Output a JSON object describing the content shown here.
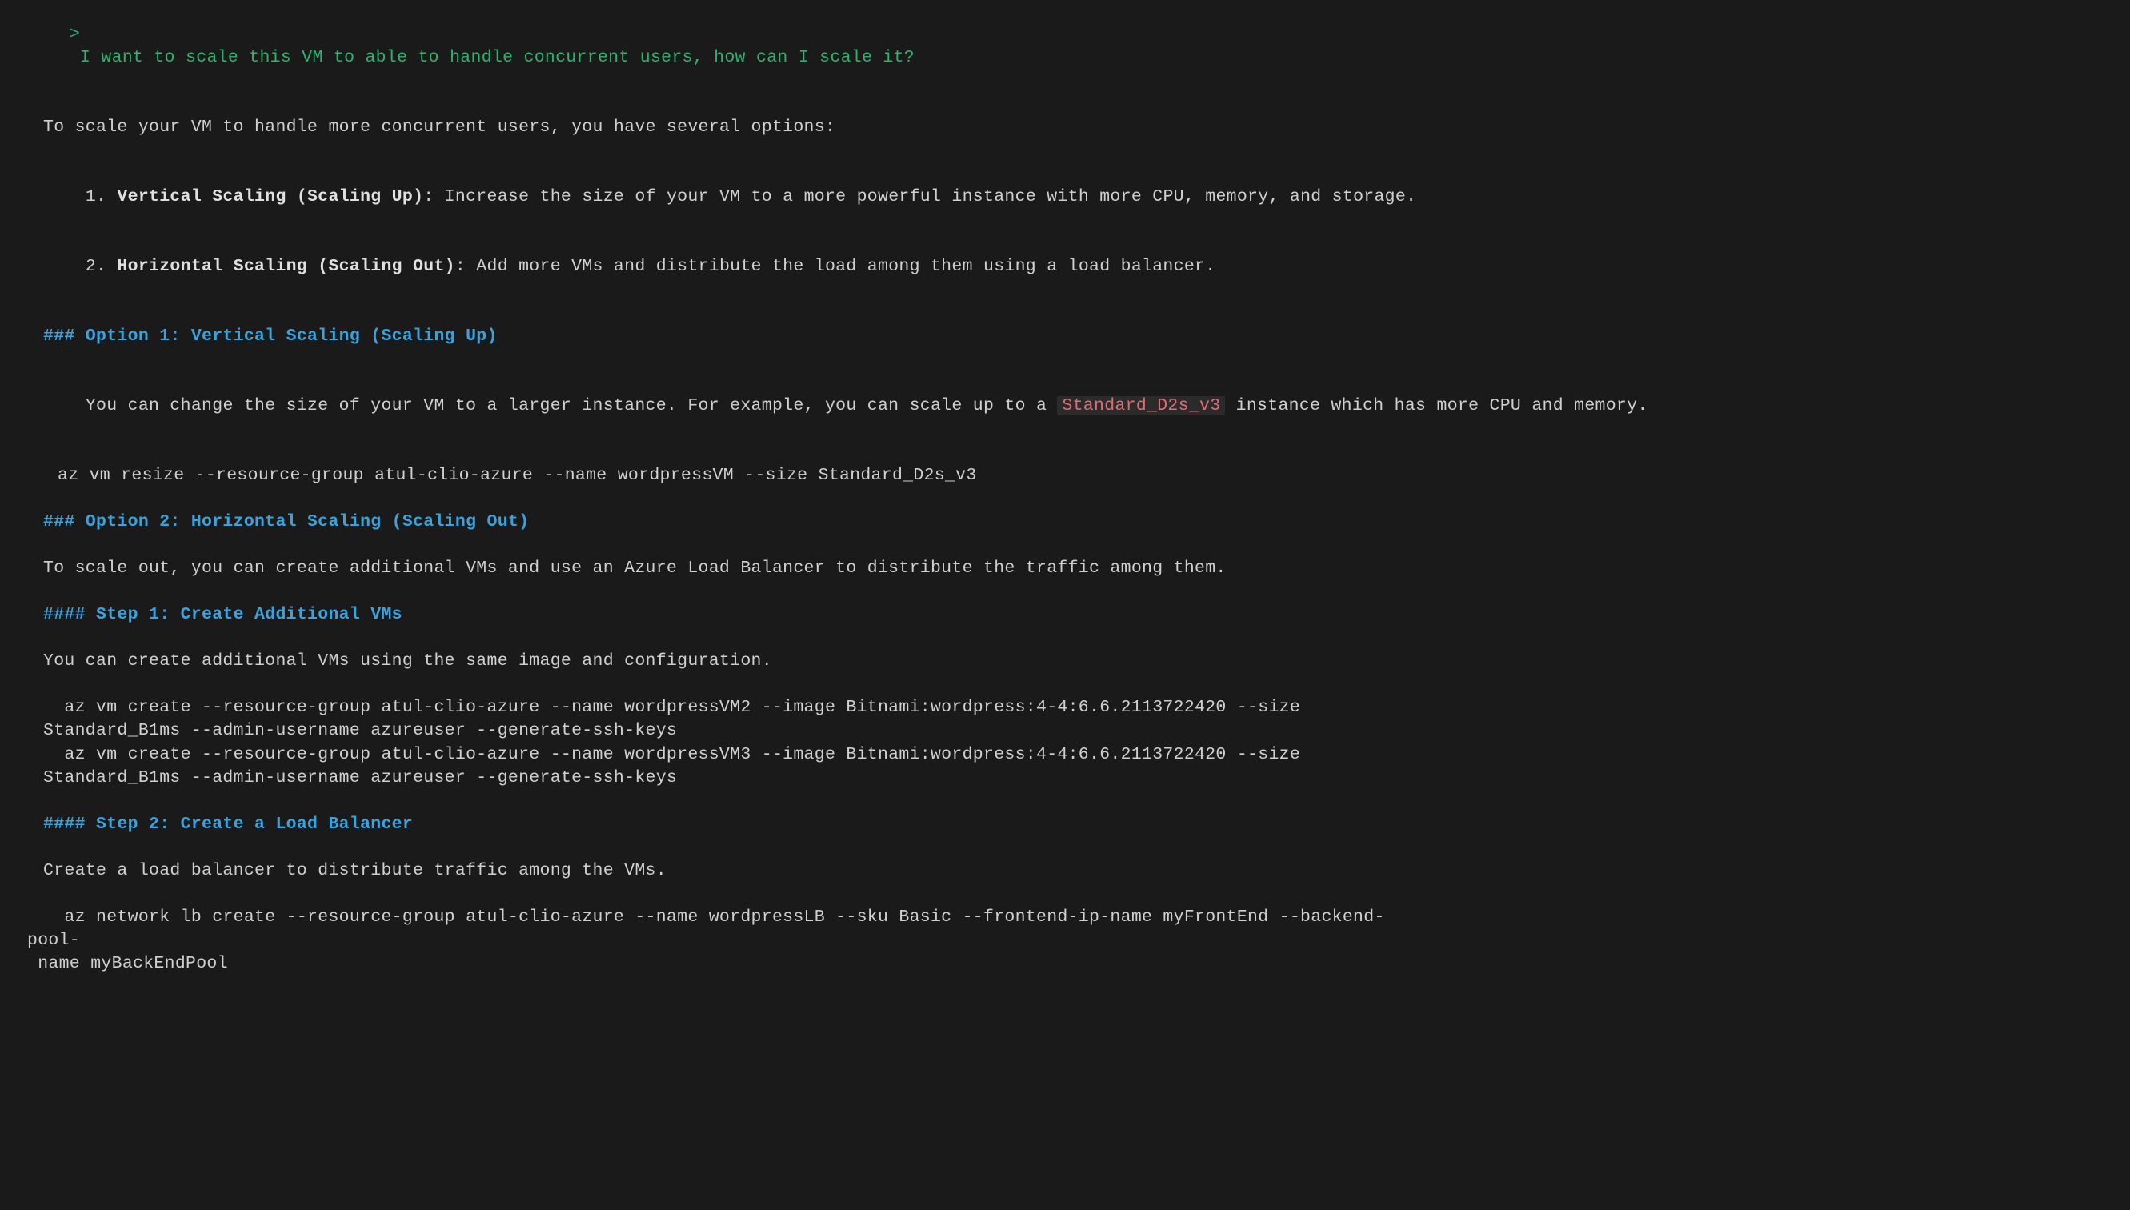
{
  "prompt_symbol": ">",
  "user_input": "I want to scale this VM to able to handle concurrent users, how can I scale it?",
  "intro": "To scale your VM to handle more concurrent users, you have several options:",
  "list": {
    "num1": "1. ",
    "item1_bold": "Vertical Scaling (Scaling Up)",
    "item1_rest": ": Increase the size of your VM to a more powerful instance with more CPU, memory, and storage.",
    "num2": "2. ",
    "item2_bold": "Horizontal Scaling (Scaling Out)",
    "item2_rest": ": Add more VMs and distribute the load among them using a load balancer."
  },
  "opt1": {
    "heading": "### Option 1: Vertical Scaling (Scaling Up)",
    "desc_pre": "You can change the size of your VM to a larger instance. For example, you can scale up to a ",
    "code": "Standard_D2s_v3",
    "desc_post": " instance which has more CPU and memory.",
    "cmd": "az vm resize --resource-group atul-clio-azure --name wordpressVM --size Standard_D2s_v3"
  },
  "opt2": {
    "heading": "### Option 2: Horizontal Scaling (Scaling Out)",
    "desc": "To scale out, you can create additional VMs and use an Azure Load Balancer to distribute the traffic among them."
  },
  "step1": {
    "heading": "#### Step 1: Create Additional VMs",
    "desc": "You can create additional VMs using the same image and configuration.",
    "cmd1a": "  az vm create --resource-group atul-clio-azure --name wordpressVM2 --image Bitnami:wordpress:4-4:6.6.2113722420 --size",
    "cmd1b": "Standard_B1ms --admin-username azureuser --generate-ssh-keys",
    "cmd2a": "  az vm create --resource-group atul-clio-azure --name wordpressVM3 --image Bitnami:wordpress:4-4:6.6.2113722420 --size",
    "cmd2b": "Standard_B1ms --admin-username azureuser --generate-ssh-keys"
  },
  "step2": {
    "heading": "#### Step 2: Create a Load Balancer",
    "desc": "Create a load balancer to distribute traffic among the VMs.",
    "cmd_a": "  az network lb create --resource-group atul-clio-azure --name wordpressLB --sku Basic --frontend-ip-name myFrontEnd --backend-",
    "cmd_b": "pool-",
    "cmd_c": " name myBackEndPool"
  }
}
